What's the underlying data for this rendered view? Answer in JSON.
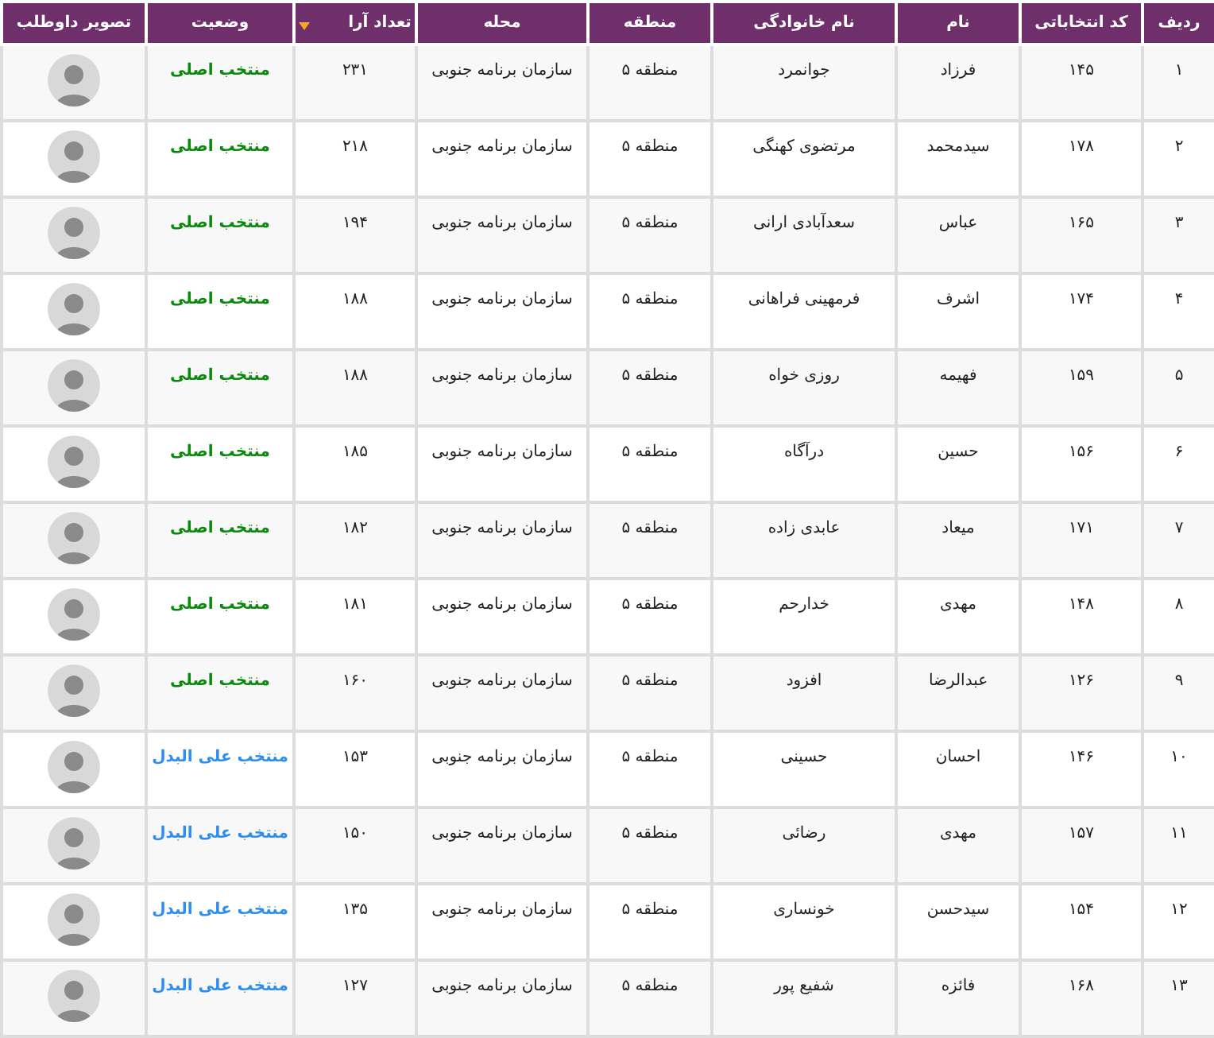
{
  "table": {
    "columns": [
      {
        "label": "ردیف",
        "sorted": false
      },
      {
        "label": "کد انتخاباتی",
        "sorted": false
      },
      {
        "label": "نام",
        "sorted": false
      },
      {
        "label": "نام خانوادگی",
        "sorted": false
      },
      {
        "label": "منطقه",
        "sorted": false
      },
      {
        "label": "محله",
        "sorted": false
      },
      {
        "label": "تعداد آرا",
        "sorted": true
      },
      {
        "label": "وضعیت",
        "sorted": false
      },
      {
        "label": "تصویر داوطلب",
        "sorted": false
      }
    ],
    "rows": [
      {
        "index": "۱",
        "code": "۱۴۵",
        "first_name": "فرزاد",
        "last_name": "جوانمرد",
        "region": "منطقه ۵",
        "district": "سازمان برنامه جنوبی",
        "votes": "۲۳۱",
        "status": {
          "kind": "main",
          "label": "منتخب اصلی"
        }
      },
      {
        "index": "۲",
        "code": "۱۷۸",
        "first_name": "سیدمحمد",
        "last_name": "مرتضوی کهنگی",
        "region": "منطقه ۵",
        "district": "سازمان برنامه جنوبی",
        "votes": "۲۱۸",
        "status": {
          "kind": "main",
          "label": "منتخب اصلی"
        }
      },
      {
        "index": "۳",
        "code": "۱۶۵",
        "first_name": "عباس",
        "last_name": "سعدآبادی ارانی",
        "region": "منطقه ۵",
        "district": "سازمان برنامه جنوبی",
        "votes": "۱۹۴",
        "status": {
          "kind": "main",
          "label": "منتخب اصلی"
        }
      },
      {
        "index": "۴",
        "code": "۱۷۴",
        "first_name": "اشرف",
        "last_name": "فرمهینی فراهانی",
        "region": "منطقه ۵",
        "district": "سازمان برنامه جنوبی",
        "votes": "۱۸۸",
        "status": {
          "kind": "main",
          "label": "منتخب اصلی"
        }
      },
      {
        "index": "۵",
        "code": "۱۵۹",
        "first_name": "فهیمه",
        "last_name": "روزی خواه",
        "region": "منطقه ۵",
        "district": "سازمان برنامه جنوبی",
        "votes": "۱۸۸",
        "status": {
          "kind": "main",
          "label": "منتخب اصلی"
        }
      },
      {
        "index": "۶",
        "code": "۱۵۶",
        "first_name": "حسین",
        "last_name": "درآگاه",
        "region": "منطقه ۵",
        "district": "سازمان برنامه جنوبی",
        "votes": "۱۸۵",
        "status": {
          "kind": "main",
          "label": "منتخب اصلی"
        }
      },
      {
        "index": "۷",
        "code": "۱۷۱",
        "first_name": "میعاد",
        "last_name": "عابدی زاده",
        "region": "منطقه ۵",
        "district": "سازمان برنامه جنوبی",
        "votes": "۱۸۲",
        "status": {
          "kind": "main",
          "label": "منتخب اصلی"
        }
      },
      {
        "index": "۸",
        "code": "۱۴۸",
        "first_name": "مهدی",
        "last_name": "خدارحم",
        "region": "منطقه ۵",
        "district": "سازمان برنامه جنوبی",
        "votes": "۱۸۱",
        "status": {
          "kind": "main",
          "label": "منتخب اصلی"
        }
      },
      {
        "index": "۹",
        "code": "۱۲۶",
        "first_name": "عبدالرضا",
        "last_name": "افزود",
        "region": "منطقه ۵",
        "district": "سازمان برنامه جنوبی",
        "votes": "۱۶۰",
        "status": {
          "kind": "main",
          "label": "منتخب اصلی"
        }
      },
      {
        "index": "۱۰",
        "code": "۱۴۶",
        "first_name": "احسان",
        "last_name": "حسینی",
        "region": "منطقه ۵",
        "district": "سازمان برنامه جنوبی",
        "votes": "۱۵۳",
        "status": {
          "kind": "alternate",
          "label": "منتخب علی البدل"
        }
      },
      {
        "index": "۱۱",
        "code": "۱۵۷",
        "first_name": "مهدی",
        "last_name": "رضائی",
        "region": "منطقه ۵",
        "district": "سازمان برنامه جنوبی",
        "votes": "۱۵۰",
        "status": {
          "kind": "alternate",
          "label": "منتخب علی البدل"
        }
      },
      {
        "index": "۱۲",
        "code": "۱۵۴",
        "first_name": "سیدحسن",
        "last_name": "خونساری",
        "region": "منطقه ۵",
        "district": "سازمان برنامه جنوبی",
        "votes": "۱۳۵",
        "status": {
          "kind": "alternate",
          "label": "منتخب علی البدل"
        }
      },
      {
        "index": "۱۳",
        "code": "۱۶۸",
        "first_name": "فائزه",
        "last_name": "شفیع پور",
        "region": "منطقه ۵",
        "district": "سازمان برنامه جنوبی",
        "votes": "۱۲۷",
        "status": {
          "kind": "alternate",
          "label": "منتخب علی البدل"
        }
      }
    ]
  }
}
